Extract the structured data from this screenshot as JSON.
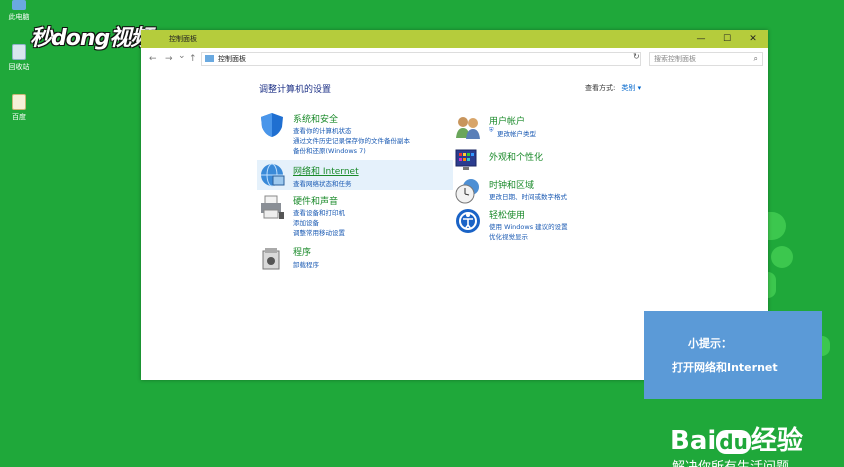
{
  "desktop": {
    "icons": [
      {
        "label": "此电脑"
      },
      {
        "label": "回收站"
      },
      {
        "label": "百度"
      }
    ],
    "watermark": "秒dong视频"
  },
  "window": {
    "title": "控制面板",
    "controls": {
      "minimize": "—",
      "maximize": "☐",
      "close": "✕"
    },
    "address": {
      "back": "←",
      "forward": "→",
      "down": "⌄",
      "up": "↑",
      "path": "控制面板",
      "refresh": "↻",
      "search_placeholder": "搜索控制面板"
    },
    "heading": "调整计算机的设置",
    "view_by": {
      "label": "查看方式:",
      "value": "类别 ▾"
    },
    "left_categories": [
      {
        "name": "系统和安全",
        "links": [
          "查看你的计算机状态",
          "通过文件历史记录保存你的文件备份副本",
          "备份和还原(Windows 7)"
        ]
      },
      {
        "name": "网络和 Internet",
        "links": [
          "查看网络状态和任务"
        ]
      },
      {
        "name": "硬件和声音",
        "links": [
          "查看设备和打印机",
          "添加设备",
          "调整常用移动设置"
        ]
      },
      {
        "name": "程序",
        "links": [
          "卸载程序"
        ]
      }
    ],
    "right_categories": [
      {
        "name": "用户帐户",
        "links": [
          "更改帐户类型"
        ]
      },
      {
        "name": "外观和个性化",
        "links": []
      },
      {
        "name": "时钟和区域",
        "links": [
          "更改日期、时间或数字格式"
        ]
      },
      {
        "name": "轻松使用",
        "links": [
          "使用 Windows 建议的设置",
          "优化视觉显示"
        ]
      }
    ]
  },
  "tip": {
    "line1": "小提示：",
    "line2": "打开网络和Internet"
  },
  "brand": {
    "name": "Bai",
    "mid": "du",
    "tail": "经验",
    "slogan": "解决你所有生活问题"
  },
  "colors": {
    "desktop": "#1fa83a",
    "titlebar": "#b5cc3c",
    "tip": "#5b9ad7",
    "category_name": "#1a8a2a",
    "link": "#1a5ab3"
  }
}
